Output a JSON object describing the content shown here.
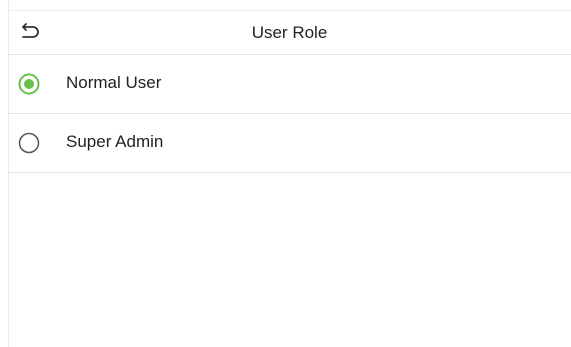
{
  "header": {
    "title": "User Role",
    "back_icon": "back-arrow-icon"
  },
  "options": [
    {
      "label": "Normal User",
      "selected": true
    },
    {
      "label": "Super Admin",
      "selected": false
    }
  ],
  "colors": {
    "accent": "#6abf4b",
    "divider": "#e2e2e2",
    "text": "#222222",
    "radio_off": "#555555"
  }
}
